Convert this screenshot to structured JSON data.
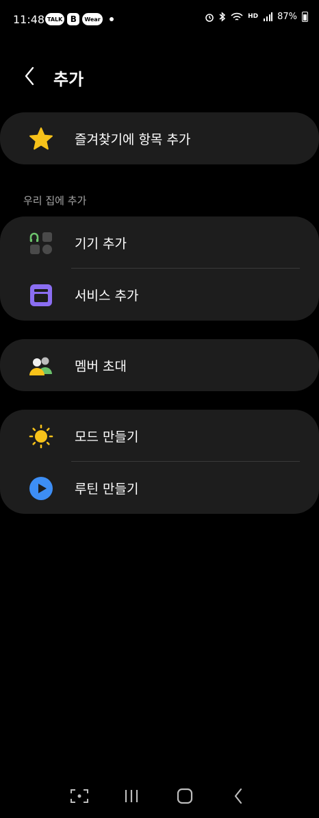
{
  "status_bar": {
    "time": "11:48",
    "app_badges": [
      "TALK",
      "B",
      "Wear"
    ],
    "hd_label": "HD",
    "battery": "87%"
  },
  "header": {
    "title": "추가"
  },
  "favorites": {
    "label": "즐겨찾기에 항목 추가",
    "icon": "star-icon",
    "icon_color": "#f7c21a"
  },
  "home_section": {
    "title": "우리 집에 추가",
    "items": [
      {
        "label": "기기 추가",
        "icon": "devices-icon"
      },
      {
        "label": "서비스 추가",
        "icon": "service-icon",
        "icon_color": "#8b6ef2"
      }
    ]
  },
  "members": {
    "label": "멤버 초대",
    "icon": "members-icon"
  },
  "automation": {
    "items": [
      {
        "label": "모드 만들기",
        "icon": "sun-icon",
        "icon_color": "#f7c21a"
      },
      {
        "label": "루틴 만들기",
        "icon": "play-icon",
        "icon_color": "#3d8ef5"
      }
    ]
  },
  "colors": {
    "background": "#000000",
    "card": "#1d1d1d",
    "divider": "#3a3a3a",
    "secondary_text": "#a7a7a7"
  }
}
